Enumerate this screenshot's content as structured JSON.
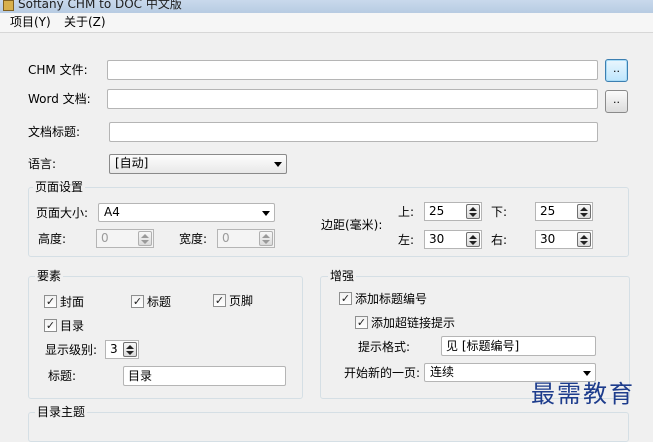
{
  "window": {
    "title": "Softany CHM to DOC 中文版"
  },
  "menu": [
    {
      "label": "项目(Y)"
    },
    {
      "label": "关于(Z)"
    }
  ],
  "fields": {
    "chm_label": "CHM 文件:",
    "chm_value": "",
    "chm_browse": "..",
    "word_label": "Word 文档:",
    "word_value": "",
    "word_browse": "..",
    "doc_title_label": "文档标题:",
    "doc_title_value": "",
    "language_label": "语言:",
    "language_value": "[自动]"
  },
  "page_setup": {
    "group_label": "页面设置",
    "page_size_label": "页面大小:",
    "page_size_value": "A4",
    "height_label": "高度:",
    "height_value": "0",
    "width_label": "宽度:",
    "width_value": "0",
    "margins_label": "边距(毫米):",
    "top_label": "上:",
    "top_value": "25",
    "bottom_label": "下:",
    "bottom_value": "25",
    "left_label": "左:",
    "left_value": "30",
    "right_label": "右:",
    "right_value": "30"
  },
  "elements": {
    "group_label": "要素",
    "cover_label": "封面",
    "cover_checked": true,
    "title_chk_label": "标题",
    "title_checked": true,
    "footer_label": "页脚",
    "footer_checked": true,
    "toc_label": "目录",
    "toc_checked": true,
    "level_label": "显示级别:",
    "level_value": "3",
    "heading_label": "标题:",
    "heading_value": "目录"
  },
  "enhance": {
    "group_label": "增强",
    "add_heading_num_label": "添加标题编号",
    "add_heading_num_checked": true,
    "add_hyperlink_tip_label": "添加超链接提示",
    "add_hyperlink_tip_checked": true,
    "tip_format_label": "提示格式:",
    "tip_format_value": "见 [标题编号]",
    "new_page_label": "开始新的一页:",
    "new_page_value": "连续"
  },
  "toc_theme": {
    "group_label": "目录主题"
  },
  "watermark": "最需教育",
  "check_glyph": "✓"
}
